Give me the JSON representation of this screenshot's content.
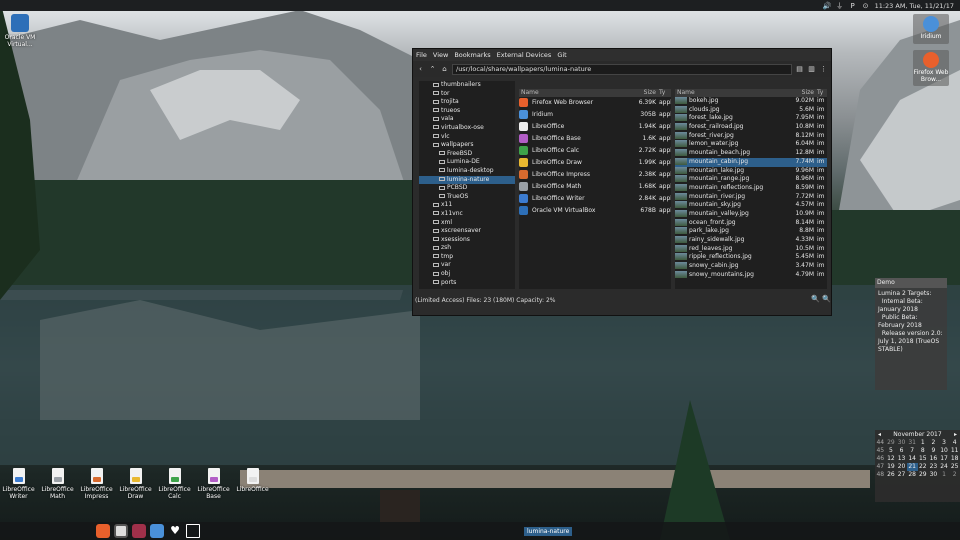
{
  "topbar": {
    "time": "11:23 AM, Tue, 11/21/17",
    "volume_icon": "volume-icon",
    "battery_icon": "battery-icon",
    "app_letter": "P"
  },
  "desktop": {
    "vbox": "Oracle VM Virtual...",
    "iridium": "Iridium",
    "firefox": "Firefox Web Brow..."
  },
  "filemgr": {
    "menu": [
      "File",
      "View",
      "Bookmarks",
      "External Devices",
      "Git"
    ],
    "path": "/usr/local/share/wallpapers/lumina-nature",
    "tree": [
      "thumbnailers",
      "tor",
      "trojita",
      "trueos",
      "vala",
      "virtualbox-ose",
      "vlc",
      "wallpapers",
      "FreeBSD",
      "Lumina-DE",
      "lumina-desktop",
      "lumina-nature",
      "PCBSD",
      "TrueOS",
      "x11",
      "x11vnc",
      "xml",
      "xscreensaver",
      "xsessions",
      "zsh",
      "tmp",
      "var",
      "obj",
      "ports"
    ],
    "apps_header": {
      "name": "Name",
      "size": "Size",
      "type": "Ty"
    },
    "apps": [
      {
        "name": "Firefox Web Browser",
        "size": "6.39K",
        "type": "appl",
        "color": "#e8602c"
      },
      {
        "name": "Iridium",
        "size": "305B",
        "type": "appl",
        "color": "#4a90d9"
      },
      {
        "name": "LibreOffice",
        "size": "1.94K",
        "type": "appl",
        "color": "#eeeeee"
      },
      {
        "name": "LibreOffice Base",
        "size": "1.6K",
        "type": "appl",
        "color": "#b25dc6"
      },
      {
        "name": "LibreOffice Calc",
        "size": "2.72K",
        "type": "appl",
        "color": "#3ea34a"
      },
      {
        "name": "LibreOffice Draw",
        "size": "1.99K",
        "type": "appl",
        "color": "#e8b830"
      },
      {
        "name": "LibreOffice Impress",
        "size": "2.38K",
        "type": "appl",
        "color": "#d76a2e"
      },
      {
        "name": "LibreOffice Math",
        "size": "1.68K",
        "type": "appl",
        "color": "#9aa0a6"
      },
      {
        "name": "LibreOffice Writer",
        "size": "2.84K",
        "type": "appl",
        "color": "#3c7cd0"
      },
      {
        "name": "Oracle VM VirtualBox",
        "size": "678B",
        "type": "appl",
        "color": "#2d6fb8"
      }
    ],
    "files": [
      {
        "name": "bokeh.jpg",
        "size": "9.02M",
        "type": "im"
      },
      {
        "name": "clouds.jpg",
        "size": "5.6M",
        "type": "im"
      },
      {
        "name": "forest_lake.jpg",
        "size": "7.95M",
        "type": "im"
      },
      {
        "name": "forest_railroad.jpg",
        "size": "10.8M",
        "type": "im"
      },
      {
        "name": "forest_river.jpg",
        "size": "8.12M",
        "type": "im"
      },
      {
        "name": "lemon_water.jpg",
        "size": "6.04M",
        "type": "im"
      },
      {
        "name": "mountain_beach.jpg",
        "size": "12.8M",
        "type": "im"
      },
      {
        "name": "mountain_cabin.jpg",
        "size": "7.74M",
        "type": "im",
        "selected": true
      },
      {
        "name": "mountain_lake.jpg",
        "size": "9.96M",
        "type": "im"
      },
      {
        "name": "mountain_range.jpg",
        "size": "8.96M",
        "type": "im"
      },
      {
        "name": "mountain_reflections.jpg",
        "size": "8.59M",
        "type": "im"
      },
      {
        "name": "mountain_river.jpg",
        "size": "7.72M",
        "type": "im"
      },
      {
        "name": "mountain_sky.jpg",
        "size": "4.57M",
        "type": "im"
      },
      {
        "name": "mountain_valley.jpg",
        "size": "10.9M",
        "type": "im"
      },
      {
        "name": "ocean_front.jpg",
        "size": "8.14M",
        "type": "im"
      },
      {
        "name": "park_lake.jpg",
        "size": "8.8M",
        "type": "im"
      },
      {
        "name": "rainy_sidewalk.jpg",
        "size": "4.33M",
        "type": "im"
      },
      {
        "name": "red_leaves.jpg",
        "size": "10.5M",
        "type": "im"
      },
      {
        "name": "ripple_reflections.jpg",
        "size": "5.45M",
        "type": "im"
      },
      {
        "name": "snowy_cabin.jpg",
        "size": "3.47M",
        "type": "im"
      },
      {
        "name": "snowy_mountains.jpg",
        "size": "4.79M",
        "type": "im"
      }
    ],
    "status": "(Limited Access) Files: 23 (180M) Capacity: 2%"
  },
  "notes": {
    "title": "Demo",
    "text": "Lumina 2 Targets:\n  Internal Beta: January 2018\n  Public Beta: February 2018\n  Release version 2.0: July 1, 2018 (TrueOS STABLE)"
  },
  "calendar": {
    "month": "November",
    "year": "2017",
    "rows": [
      [
        "44",
        "29",
        "30",
        "31",
        "1",
        "2",
        "3",
        "4"
      ],
      [
        "45",
        "5",
        "6",
        "7",
        "8",
        "9",
        "10",
        "11"
      ],
      [
        "46",
        "12",
        "13",
        "14",
        "15",
        "16",
        "17",
        "18"
      ],
      [
        "47",
        "19",
        "20",
        "21",
        "22",
        "23",
        "24",
        "25"
      ],
      [
        "48",
        "26",
        "27",
        "28",
        "29",
        "30",
        "1",
        "2"
      ]
    ]
  },
  "dock": [
    {
      "label": "LibreOffice Writer",
      "color": "#3c7cd0"
    },
    {
      "label": "LibreOffice Math",
      "color": "#9aa0a6"
    },
    {
      "label": "LibreOffice Impress",
      "color": "#d76a2e"
    },
    {
      "label": "LibreOffice Draw",
      "color": "#e8b830"
    },
    {
      "label": "LibreOffice Calc",
      "color": "#3ea34a"
    },
    {
      "label": "LibreOffice Base",
      "color": "#b25dc6"
    },
    {
      "label": "LibreOffice",
      "color": "#dddddd"
    }
  ],
  "taskbar": {
    "task_label": "lumina-nature"
  }
}
